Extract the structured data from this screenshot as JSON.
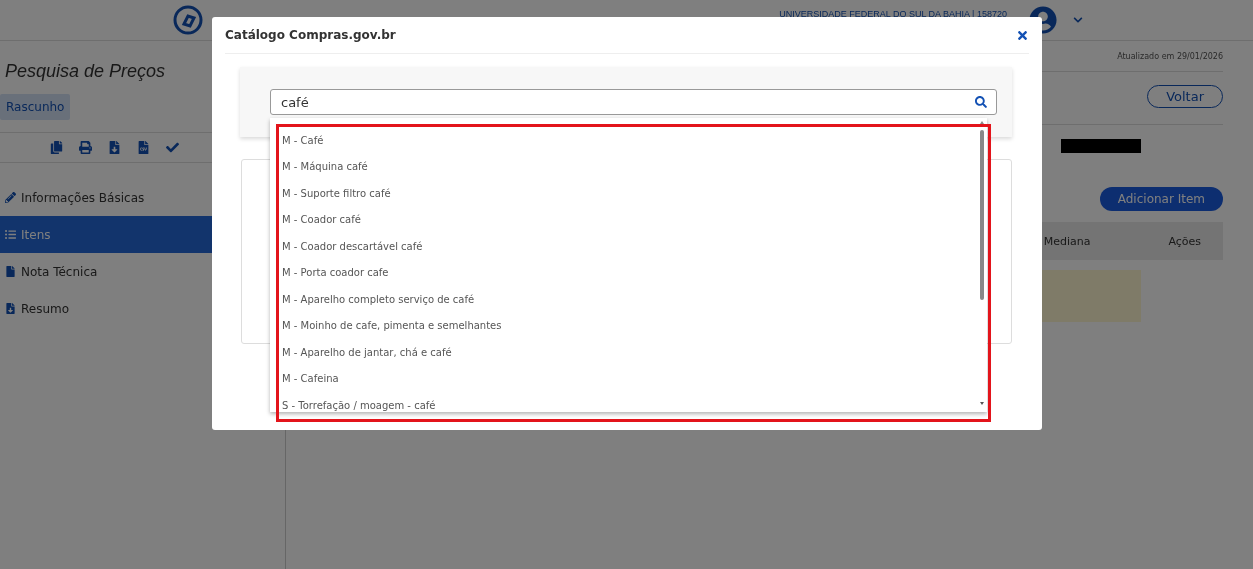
{
  "header": {
    "organization": "UNIVERSIDADE FEDERAL DO SUL DA BAHIA | 158720"
  },
  "sidebar": {
    "title": "Pesquisa de Preços",
    "status": "Rascunho",
    "nav": [
      {
        "label": "Informações Básicas",
        "selected": false
      },
      {
        "label": "Itens",
        "selected": true
      },
      {
        "label": "Nota Técnica",
        "selected": false
      },
      {
        "label": "Resumo",
        "selected": false
      }
    ]
  },
  "main": {
    "updated": "Atualizado em 29/01/2026",
    "back_button": "Voltar",
    "add_button": "Adicionar Item",
    "table": {
      "columns": [
        "Mediana",
        "Ações"
      ]
    }
  },
  "modal": {
    "title": "Catálogo Compras.gov.br",
    "search": {
      "value": "café"
    },
    "results": [
      "M - Café",
      "M - Máquina café",
      "M - Suporte filtro café",
      "M - Coador café",
      "M - Coador descartável café",
      "M - Porta coador cafe",
      "M - Aparelho completo serviço de café",
      "M - Moinho de cafe, pimenta e semelhantes",
      "M - Aparelho de jantar, chá e café",
      "M - Cafeina",
      "S - Torrefação / moagem - café"
    ]
  }
}
